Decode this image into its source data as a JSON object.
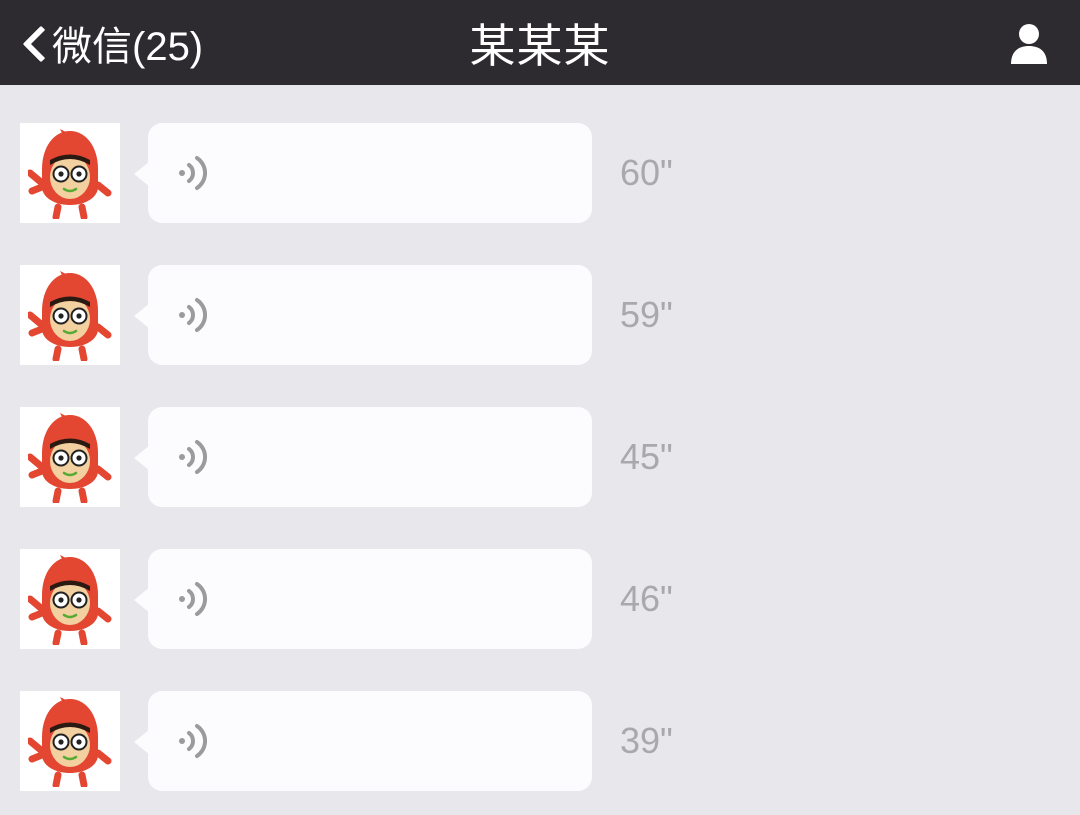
{
  "header": {
    "back_label": "微信(25)",
    "title": "某某某"
  },
  "messages": [
    {
      "duration": "60\""
    },
    {
      "duration": "59\""
    },
    {
      "duration": "45\""
    },
    {
      "duration": "46\""
    },
    {
      "duration": "39\""
    }
  ]
}
